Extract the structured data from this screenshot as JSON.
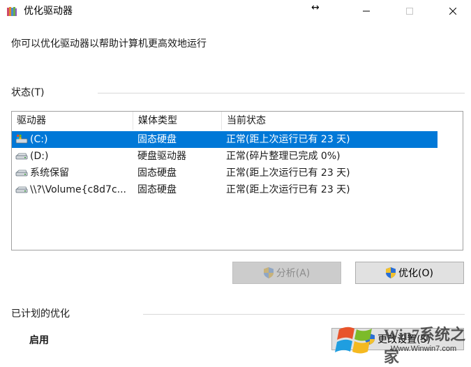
{
  "window": {
    "title": "优化驱动器",
    "resize_cursor": "↔",
    "controls": [
      "minimize-icon",
      "maximize-icon",
      "close-icon"
    ]
  },
  "intro_text": "你可以优化驱动器以帮助计算机更高效地运行",
  "status": {
    "label": "状态(T)",
    "columns": [
      "驱动器",
      "媒体类型",
      "当前状态"
    ],
    "drives": [
      {
        "name": "(C:)",
        "media": "固态硬盘",
        "state": "正常(距上次运行已有 23 天)",
        "selected": true,
        "icon": "windows-drive-icon"
      },
      {
        "name": "(D:)",
        "media": "硬盘驱动器",
        "state": "正常(碎片整理已完成 0%)",
        "selected": false,
        "icon": "drive-icon"
      },
      {
        "name": "系统保留",
        "media": "固态硬盘",
        "state": "正常(距上次运行已有 23 天)",
        "selected": false,
        "icon": "drive-icon"
      },
      {
        "name": "\\\\?\\Volume{c8d7c...",
        "media": "固态硬盘",
        "state": "正常(距上次运行已有 23 天)",
        "selected": false,
        "icon": "drive-icon"
      }
    ]
  },
  "buttons": {
    "analyze": "分析(A)",
    "optimize": "优化(O)",
    "change_settings": "更改设置(S)"
  },
  "schedule": {
    "label": "已计划的优化",
    "enabled": "启用"
  },
  "watermark": {
    "text": "Win7系统之家",
    "url": "Www.Winwin7.com"
  },
  "colors": {
    "selection": "#0078d7",
    "button_bg": "#e1e1e1",
    "disabled_bg": "#cccccc"
  }
}
